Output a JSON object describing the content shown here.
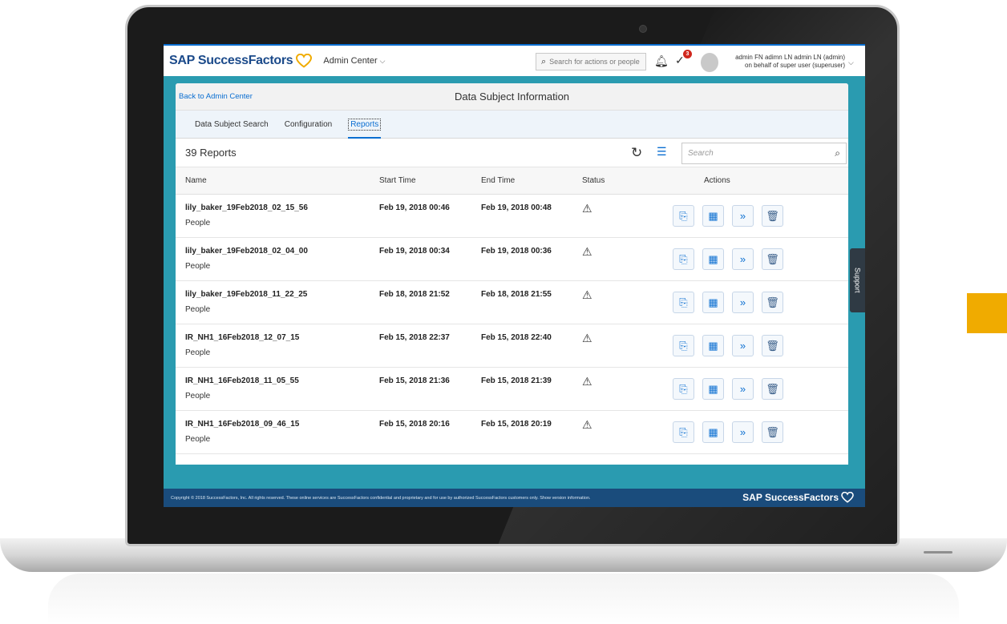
{
  "shell": {
    "brand": "SAP SuccessFactors",
    "center_menu": "Admin Center",
    "search_placeholder": "Search for actions or people",
    "notifications_badge": "3",
    "user_line1": "admin FN adimn LN admin LN (admin)",
    "user_line2": "on behalf of super user (superuser)"
  },
  "page": {
    "back_link": "Back to Admin Center",
    "title": "Data Subject Information"
  },
  "tabs": [
    {
      "label": "Data Subject Search"
    },
    {
      "label": "Configuration"
    },
    {
      "label": "Reports",
      "active": true
    }
  ],
  "toolbar": {
    "count_label": "39 Reports",
    "search_placeholder": "Search"
  },
  "columns": {
    "name": "Name",
    "start": "Start Time",
    "end": "End Time",
    "status": "Status",
    "actions": "Actions"
  },
  "rows": [
    {
      "name": "lily_baker_19Feb2018_02_15_56",
      "type": "People",
      "start": "Feb 19, 2018 00:46",
      "end": "Feb 19, 2018 00:48"
    },
    {
      "name": "lily_baker_19Feb2018_02_04_00",
      "type": "People",
      "start": "Feb 19, 2018 00:34",
      "end": "Feb 19, 2018 00:36"
    },
    {
      "name": "lily_baker_19Feb2018_11_22_25",
      "type": "People",
      "start": "Feb 18, 2018 21:52",
      "end": "Feb 18, 2018 21:55"
    },
    {
      "name": "IR_NH1_16Feb2018_12_07_15",
      "type": "People",
      "start": "Feb 15, 2018 22:37",
      "end": "Feb 15, 2018 22:40"
    },
    {
      "name": "IR_NH1_16Feb2018_11_05_55",
      "type": "People",
      "start": "Feb 15, 2018 21:36",
      "end": "Feb 15, 2018 21:39"
    },
    {
      "name": "IR_NH1_16Feb2018_09_46_15",
      "type": "People",
      "start": "Feb 15, 2018 20:16",
      "end": "Feb 15, 2018 20:19"
    }
  ],
  "support_label": "Support",
  "footer": {
    "copyright": "Copyright © 2018 SuccessFactors, Inc. All rights reserved. These online services are SuccessFactors confidential and proprietary and for use by authorized SuccessFactors customers only. Show version information.",
    "brand": "SAP SuccessFactors"
  },
  "colors": {
    "brand_blue": "#1b4a8a",
    "accent_blue": "#0a6ed1",
    "heart_orange": "#f0ab00",
    "footer_blue": "#1a4c7c",
    "shell_teal": "#2a9bb0"
  },
  "icons": {
    "status": "warning-icon",
    "actions": [
      "export-pdf-icon",
      "export-excel-icon",
      "forward-icon",
      "delete-icon"
    ]
  }
}
